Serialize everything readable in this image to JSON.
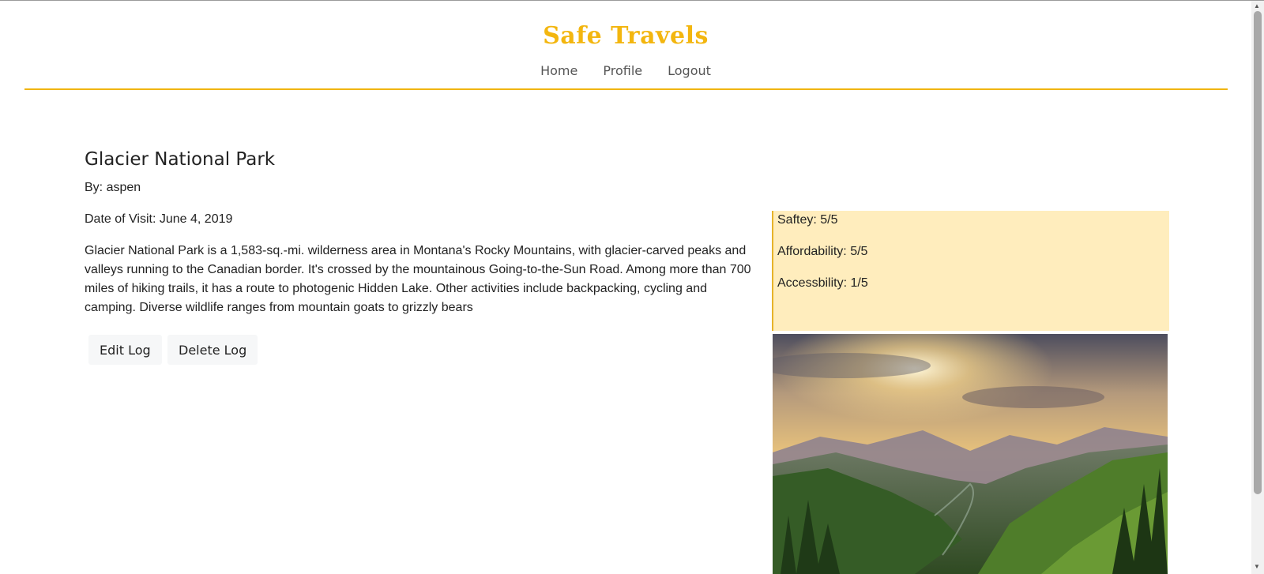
{
  "header": {
    "brand": "Safe Travels",
    "nav": {
      "home": "Home",
      "profile": "Profile",
      "logout": "Logout"
    },
    "accent_color": "#f3b60f"
  },
  "log": {
    "title": "Glacier National Park",
    "author": "By: aspen",
    "date_of_visit": "Date of Visit: June 4, 2019",
    "description": "Glacier National Park is a 1,583-sq.-mi. wilderness area in Montana's Rocky Mountains, with glacier-carved peaks and valleys running to the Canadian border. It's crossed by the mountainous Going-to-the-Sun Road. Among more than 700 miles of hiking trails, it has a route to photogenic Hidden Lake. Other activities include backpacking, cycling and camping. Diverse wildlife ranges from mountain goats to grizzly bears",
    "buttons": {
      "edit": "Edit Log",
      "delete": "Delete Log"
    }
  },
  "ratings": {
    "safety": "Saftey: 5/5",
    "affordability": "Affordability: 5/5",
    "accessibility": "Accessbility: 1/5",
    "panel_color": "#ffedbd"
  },
  "photo": {
    "subject": "mountain-valley-sunset-photo"
  }
}
